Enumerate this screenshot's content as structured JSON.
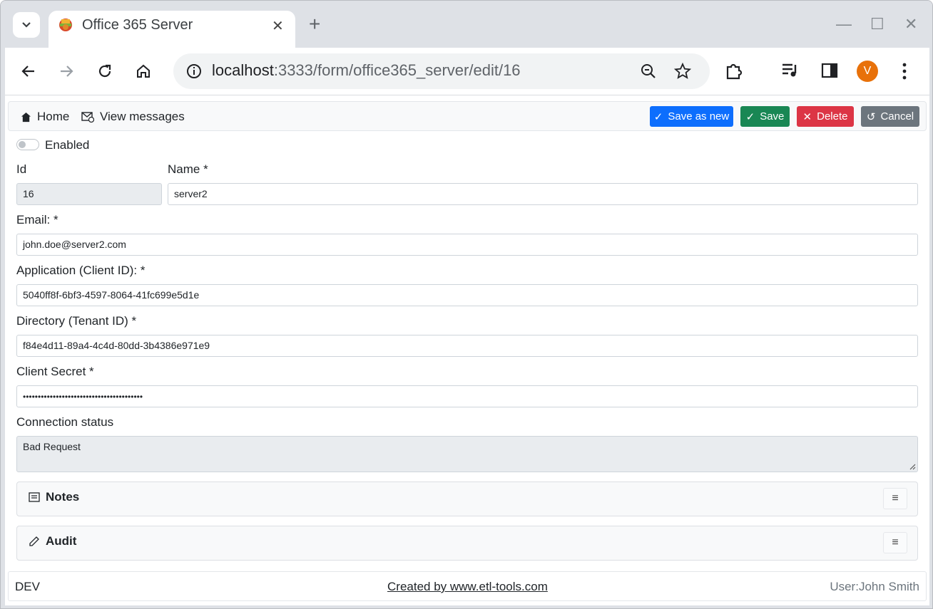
{
  "browser": {
    "tab_title": "Office 365 Server",
    "url_host": "localhost",
    "url_path": ":3333/form/office365_server/edit/16",
    "profile_initial": "V"
  },
  "appbar": {
    "home_label": "Home",
    "messages_label": "View messages",
    "save_as_new_label": "Save as new",
    "save_label": "Save",
    "delete_label": "Delete",
    "cancel_label": "Cancel"
  },
  "form": {
    "enabled_label": "Enabled",
    "enabled": false,
    "id_label": "Id",
    "id_value": "16",
    "name_label": "Name *",
    "name_value": "server2",
    "email_label": "Email: *",
    "email_value": "john.doe@server2.com",
    "client_id_label": "Application (Client ID): *",
    "client_id_value": "5040ff8f-6bf3-4597-8064-41fc699e5d1e",
    "tenant_id_label": "Directory (Tenant ID) *",
    "tenant_id_value": "f84e4d11-89a4-4c4d-80dd-3b4386e971e9",
    "secret_label": "Client Secret *",
    "secret_value": "••••••••••••••••••••••••••••••••••••••••",
    "status_label": "Connection status",
    "status_value": "Bad Request"
  },
  "panels": {
    "notes_title": "Notes",
    "audit_title": "Audit",
    "menu_glyph": "≡"
  },
  "footer": {
    "env": "DEV",
    "credit": "Created by www.etl-tools.com",
    "user": "User:John Smith"
  },
  "colors": {
    "primary": "#0d6efd",
    "success": "#198754",
    "danger": "#dc3545",
    "secondary": "#6c757d",
    "avatar": "#e8710a"
  }
}
